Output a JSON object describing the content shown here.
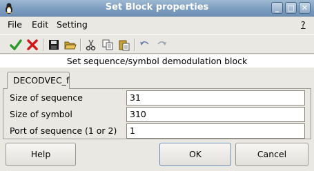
{
  "window": {
    "title": "Set Block properties",
    "controls": [
      "_",
      "□",
      "✕"
    ]
  },
  "menu": {
    "file": "File",
    "edit": "Edit",
    "setting": "Setting",
    "help": "?"
  },
  "toolbar": {
    "icons": [
      "check-icon",
      "cross-icon",
      "save-icon",
      "open-folder-icon",
      "cut-icon",
      "copy-icon",
      "paste-icon",
      "undo-icon",
      "redo-icon"
    ]
  },
  "description": "Set sequence/symbol demodulation block",
  "tab": {
    "label": "DECODVEC_f"
  },
  "fields": [
    {
      "label": "Size of sequence",
      "value": "31"
    },
    {
      "label": "Size of symbol",
      "value": "310"
    },
    {
      "label": "Port of sequence (1 or 2)",
      "value": "1"
    }
  ],
  "buttons": {
    "help": "Help",
    "ok": "OK",
    "cancel": "Cancel"
  },
  "colors": {
    "titlebar": "#7d9ec0",
    "check": "#2e9a2e",
    "cross": "#d01818"
  }
}
